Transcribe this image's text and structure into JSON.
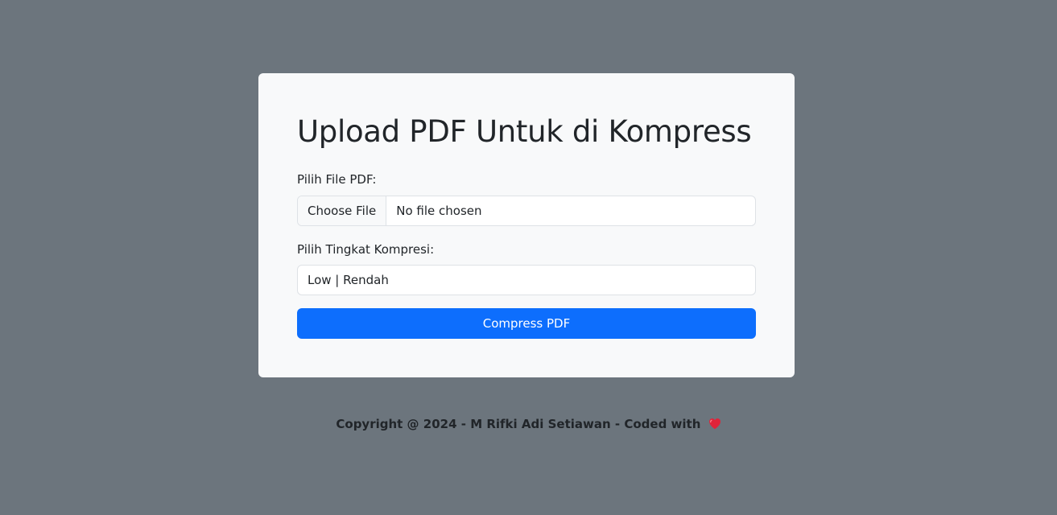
{
  "form": {
    "title": "Upload PDF Untuk di Kompress",
    "file_label": "Pilih File PDF:",
    "file_button": "Choose File",
    "file_status": "No file chosen",
    "level_label": "Pilih Tingkat Kompresi:",
    "level_selected": "Low | Rendah",
    "submit_label": "Compress PDF"
  },
  "footer": {
    "text": "Copyright @ 2024 - M Rifki Adi Setiawan - Coded with",
    "icon": "heart-icon"
  },
  "colors": {
    "background": "#6c757d",
    "card": "#f8f9fa",
    "primary": "#0d6efd",
    "heart": "#e0243a"
  }
}
